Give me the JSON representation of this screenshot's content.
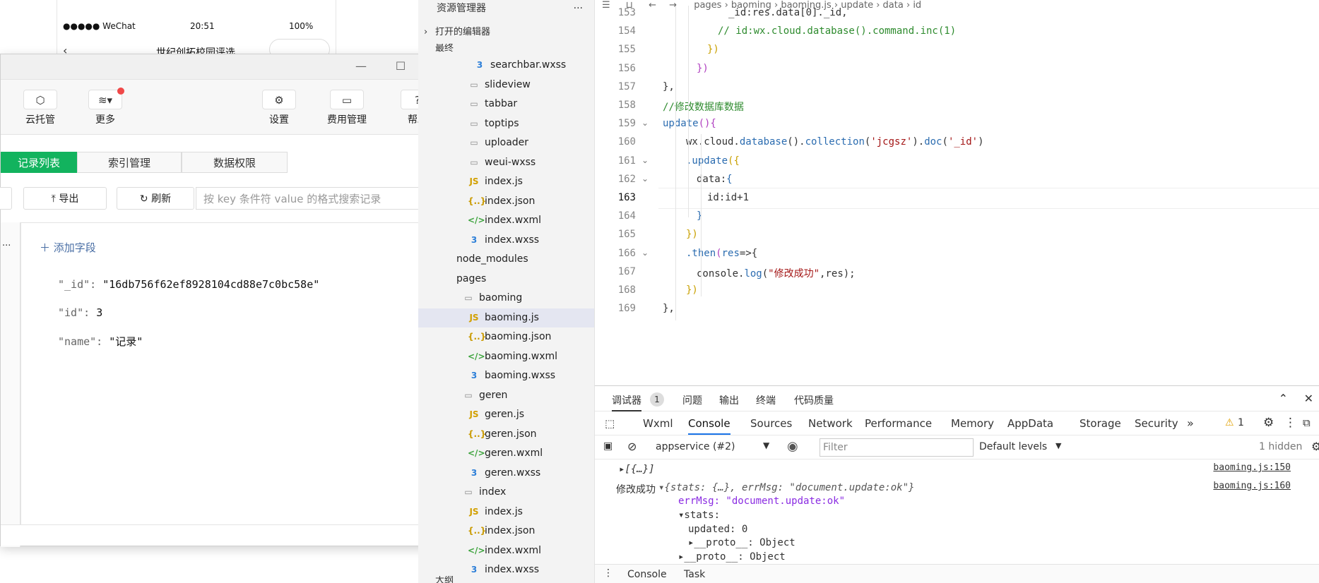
{
  "phone": {
    "carrier": "●●●●● WeChat",
    "time": "20:51",
    "battery": "100%",
    "nav_title": "世纪创拓校园评选"
  },
  "cloud": {
    "toolbar": [
      {
        "label": "云托管",
        "icon": "cube-icon"
      },
      {
        "label": "更多",
        "icon": "layers-icon"
      },
      {
        "label": "设置",
        "icon": "gear-icon"
      },
      {
        "label": "费用管理",
        "icon": "billing-icon"
      },
      {
        "label": "帮助",
        "icon": "help-icon"
      }
    ],
    "tabs": [
      "记录列表",
      "索引管理",
      "数据权限"
    ],
    "actions": {
      "export": "导出",
      "refresh": "刷新"
    },
    "search_placeholder": "按 key 条件符 value 的格式搜索记录",
    "add_field": "添加字段",
    "list_more": "...",
    "fields": [
      {
        "key": "\"_id\":",
        "value": "\"16db756f62ef8928104cd88e7c0bc58e\""
      },
      {
        "key": "\"id\":",
        "value": "3"
      },
      {
        "key": "\"name\":",
        "value": "\"记录\""
      }
    ]
  },
  "explorer": {
    "title": "资源管理器",
    "more": "···",
    "open_editors": "打开的编辑器",
    "section_top": "最终",
    "section_bottom": "大纲",
    "files": [
      {
        "name": "searchbar.wxss",
        "type": "wxss",
        "indent": 3
      },
      {
        "name": "slideview",
        "type": "folder",
        "indent": 2
      },
      {
        "name": "tabbar",
        "type": "folder",
        "indent": 2
      },
      {
        "name": "toptips",
        "type": "folder",
        "indent": 2
      },
      {
        "name": "uploader",
        "type": "folder",
        "indent": 2
      },
      {
        "name": "weui-wxss",
        "type": "folder",
        "indent": 2
      },
      {
        "name": "index.js",
        "type": "js",
        "indent": 2
      },
      {
        "name": "index.json",
        "type": "json",
        "indent": 2
      },
      {
        "name": "index.wxml",
        "type": "wxml",
        "indent": 2
      },
      {
        "name": "index.wxss",
        "type": "wxss",
        "indent": 2
      },
      {
        "name": "node_modules",
        "type": "plain",
        "indent": 0
      },
      {
        "name": "pages",
        "type": "plain",
        "indent": 0
      },
      {
        "name": "baoming",
        "type": "folder",
        "indent": 1
      },
      {
        "name": "baoming.js",
        "type": "js",
        "indent": 2,
        "selected": true
      },
      {
        "name": "baoming.json",
        "type": "json",
        "indent": 2
      },
      {
        "name": "baoming.wxml",
        "type": "wxml",
        "indent": 2
      },
      {
        "name": "baoming.wxss",
        "type": "wxss",
        "indent": 2
      },
      {
        "name": "geren",
        "type": "folder",
        "indent": 1
      },
      {
        "name": "geren.js",
        "type": "js",
        "indent": 2
      },
      {
        "name": "geren.json",
        "type": "json",
        "indent": 2
      },
      {
        "name": "geren.wxml",
        "type": "wxml",
        "indent": 2
      },
      {
        "name": "geren.wxss",
        "type": "wxss",
        "indent": 2
      },
      {
        "name": "index",
        "type": "folder",
        "indent": 1
      },
      {
        "name": "index.js",
        "type": "js",
        "indent": 2
      },
      {
        "name": "index.json",
        "type": "json",
        "indent": 2
      },
      {
        "name": "index.wxml",
        "type": "wxml",
        "indent": 2
      },
      {
        "name": "index.wxss",
        "type": "wxss",
        "indent": 2
      }
    ]
  },
  "editor": {
    "breadcrumb": [
      "pages",
      "baoming",
      "baoming.js",
      "update",
      "data",
      "id"
    ],
    "current_line": 163,
    "lines": [
      {
        "n": 153,
        "indent": 5,
        "parts": [
          [
            "_id:res.data[0]._id,",
            "#333"
          ]
        ]
      },
      {
        "n": 154,
        "indent": 4,
        "parts": [
          [
            "// id:wx.cloud.database().command.inc(1)",
            "#2e8b2e"
          ]
        ]
      },
      {
        "n": 155,
        "indent": 3,
        "parts": [
          [
            "})",
            "#c9a000"
          ]
        ]
      },
      {
        "n": 156,
        "indent": 2,
        "parts": [
          [
            "})",
            "#b040c0"
          ]
        ]
      },
      {
        "n": 157,
        "indent": 0,
        "parts": [
          [
            "},",
            "#333"
          ]
        ]
      },
      {
        "n": 158,
        "indent": 0,
        "parts": [
          [
            "//修改数据库数据",
            "#2e8b2e"
          ]
        ]
      },
      {
        "n": 159,
        "indent": 0,
        "fold": true,
        "parts": [
          [
            "update",
            "#2b6cb0"
          ],
          [
            "(){",
            "#b040c0"
          ]
        ]
      },
      {
        "n": 160,
        "indent": 1,
        "parts": [
          [
            "wx.cloud.",
            "#333"
          ],
          [
            "database",
            "#2b6cb0"
          ],
          [
            "().",
            "#333"
          ],
          [
            "collection",
            "#2b6cb0"
          ],
          [
            "(",
            "#333"
          ],
          [
            "'jcgsz'",
            "#a31515"
          ],
          [
            ").",
            "#333"
          ],
          [
            "doc",
            "#2b6cb0"
          ],
          [
            "(",
            "#333"
          ],
          [
            "'_id'",
            "#a31515"
          ],
          [
            ")",
            "#333"
          ]
        ]
      },
      {
        "n": 161,
        "indent": 1,
        "fold": true,
        "parts": [
          [
            ".update",
            "#2b6cb0"
          ],
          [
            "({",
            "#c9a000"
          ]
        ]
      },
      {
        "n": 162,
        "indent": 2,
        "fold": true,
        "parts": [
          [
            "data:",
            "#333"
          ],
          [
            "{",
            "#2b6cb0"
          ]
        ]
      },
      {
        "n": 163,
        "indent": 3,
        "parts": [
          [
            "id:id+1",
            "#333"
          ]
        ]
      },
      {
        "n": 164,
        "indent": 2,
        "parts": [
          [
            "}",
            "#2b6cb0"
          ]
        ]
      },
      {
        "n": 165,
        "indent": 1,
        "parts": [
          [
            "})",
            "#c9a000"
          ]
        ]
      },
      {
        "n": 166,
        "indent": 1,
        "fold": true,
        "parts": [
          [
            ".then",
            "#2b6cb0"
          ],
          [
            "(",
            "#b040c0"
          ],
          [
            "res",
            "#2b6cb0"
          ],
          [
            "=>{",
            "#333"
          ]
        ]
      },
      {
        "n": 167,
        "indent": 2,
        "parts": [
          [
            "console.",
            "#333"
          ],
          [
            "log",
            "#2b6cb0"
          ],
          [
            "(",
            "#333"
          ],
          [
            "\"修改成功\"",
            "#a31515"
          ],
          [
            ",res);",
            "#333"
          ]
        ]
      },
      {
        "n": 168,
        "indent": 1,
        "parts": [
          [
            "})",
            "#c9a000"
          ]
        ]
      },
      {
        "n": 169,
        "indent": 0,
        "parts": [
          [
            "},",
            "#333"
          ]
        ]
      }
    ]
  },
  "devtools": {
    "panel_tabs": [
      "调试器",
      "问题",
      "输出",
      "终端",
      "代码质量"
    ],
    "debugger_badge": "1",
    "tabs": [
      "Wxml",
      "Console",
      "Sources",
      "Network",
      "Performance",
      "Memory",
      "AppData",
      "Storage",
      "Security"
    ],
    "active_tab": "Console",
    "more_tabs": "»",
    "warning_count": "1",
    "context": "appservice (#2)",
    "filter_placeholder": "Filter",
    "levels": "Default levels",
    "hidden": "1 hidden",
    "console": [
      {
        "prefix": "",
        "text": "▸[{…}]",
        "link": "baoming.js:150"
      },
      {
        "prefix": "修改成功",
        "text": "▾{stats: {…}, errMsg: \"document.update:ok\"}",
        "link": "baoming.js:160"
      },
      {
        "prefix": "",
        "text": "errMsg: \"document.update:ok\"",
        "link": ""
      },
      {
        "prefix": "",
        "text": "▾stats:",
        "link": ""
      },
      {
        "prefix": "",
        "text": "updated: 0",
        "link": ""
      },
      {
        "prefix": "",
        "text": "▸__proto__: Object",
        "link": ""
      },
      {
        "prefix": "",
        "text": "▸__proto__: Object",
        "link": ""
      }
    ],
    "drawer_tabs": [
      "Console",
      "Task"
    ]
  }
}
